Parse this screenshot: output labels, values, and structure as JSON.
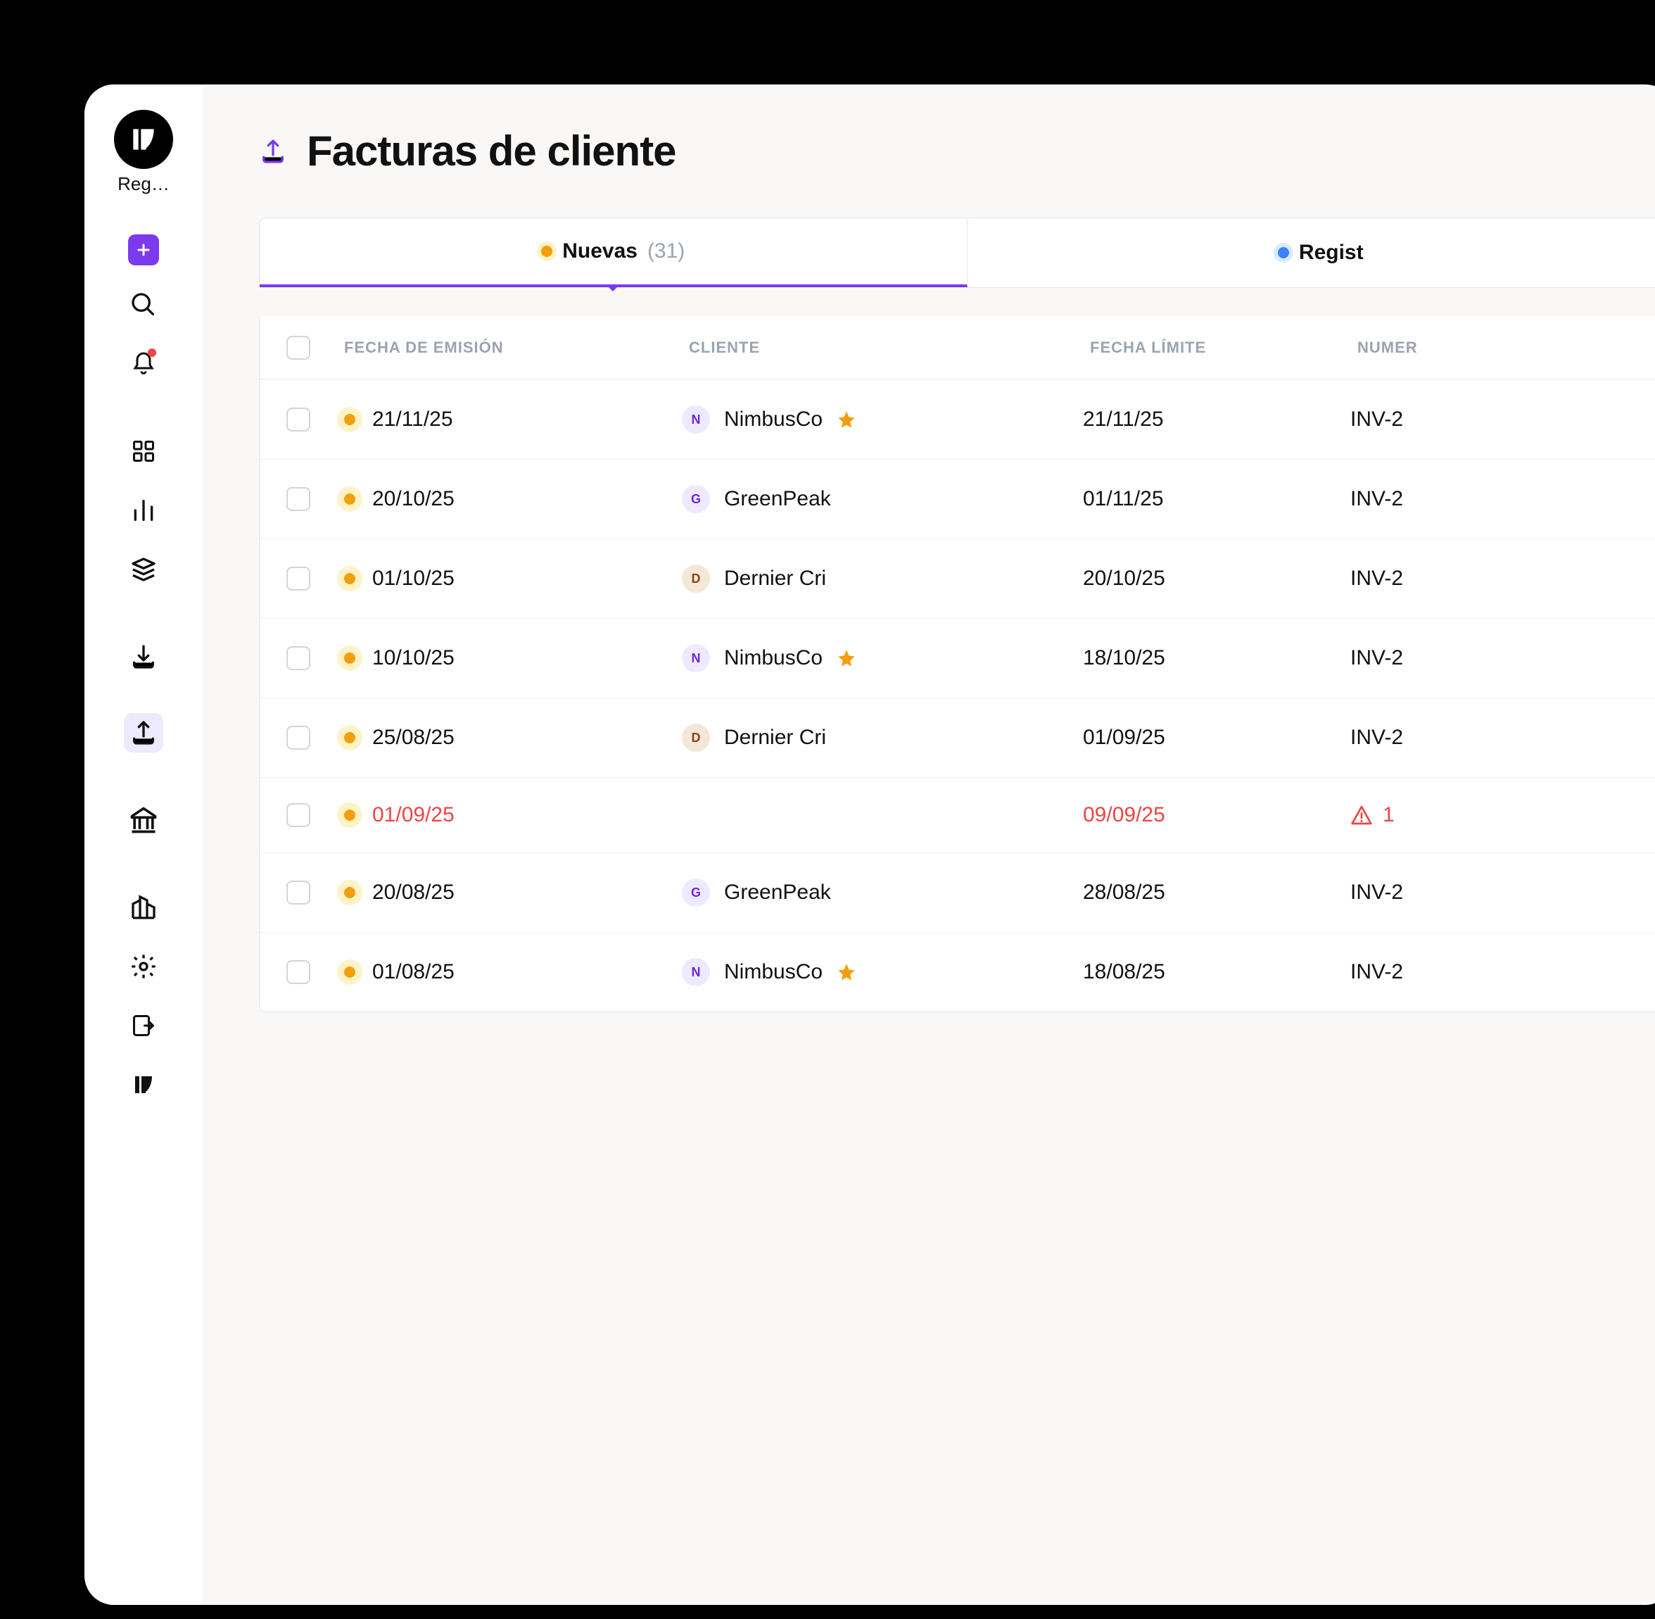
{
  "sidebar": {
    "logo_label": "Reg…"
  },
  "header": {
    "title": "Facturas de cliente"
  },
  "tabs": [
    {
      "label": "Nuevas",
      "count": "(31)",
      "color": "orange",
      "active": true
    },
    {
      "label": "Regist",
      "count": "",
      "color": "blue",
      "active": false
    }
  ],
  "columns": {
    "emit": "FECHA DE EMISIÓN",
    "client": "CLIENTE",
    "due": "FECHA LÍMITE",
    "num": "NUMER"
  },
  "rows": [
    {
      "emit": "21/11/25",
      "client_initial": "N",
      "client_name": "NimbusCo",
      "client_avatar": "n",
      "starred": true,
      "due": "21/11/25",
      "num": "INV-2",
      "danger": false
    },
    {
      "emit": "20/10/25",
      "client_initial": "G",
      "client_name": "GreenPeak",
      "client_avatar": "g",
      "starred": false,
      "due": "01/11/25",
      "num": "INV-2",
      "danger": false
    },
    {
      "emit": "01/10/25",
      "client_initial": "D",
      "client_name": "Dernier Cri",
      "client_avatar": "d",
      "starred": false,
      "due": "20/10/25",
      "num": "INV-2",
      "danger": false
    },
    {
      "emit": "10/10/25",
      "client_initial": "N",
      "client_name": "NimbusCo",
      "client_avatar": "n",
      "starred": true,
      "due": "18/10/25",
      "num": "INV-2",
      "danger": false
    },
    {
      "emit": "25/08/25",
      "client_initial": "D",
      "client_name": "Dernier Cri",
      "client_avatar": "d",
      "starred": false,
      "due": "01/09/25",
      "num": "INV-2",
      "danger": false
    },
    {
      "emit": "01/09/25",
      "client_initial": "",
      "client_name": "",
      "client_avatar": "",
      "starred": false,
      "due": "09/09/25",
      "num": "1",
      "danger": true
    },
    {
      "emit": "20/08/25",
      "client_initial": "G",
      "client_name": "GreenPeak",
      "client_avatar": "g",
      "starred": false,
      "due": "28/08/25",
      "num": "INV-2",
      "danger": false
    },
    {
      "emit": "01/08/25",
      "client_initial": "N",
      "client_name": "NimbusCo",
      "client_avatar": "n",
      "starred": true,
      "due": "18/08/25",
      "num": "INV-2",
      "danger": false
    }
  ]
}
